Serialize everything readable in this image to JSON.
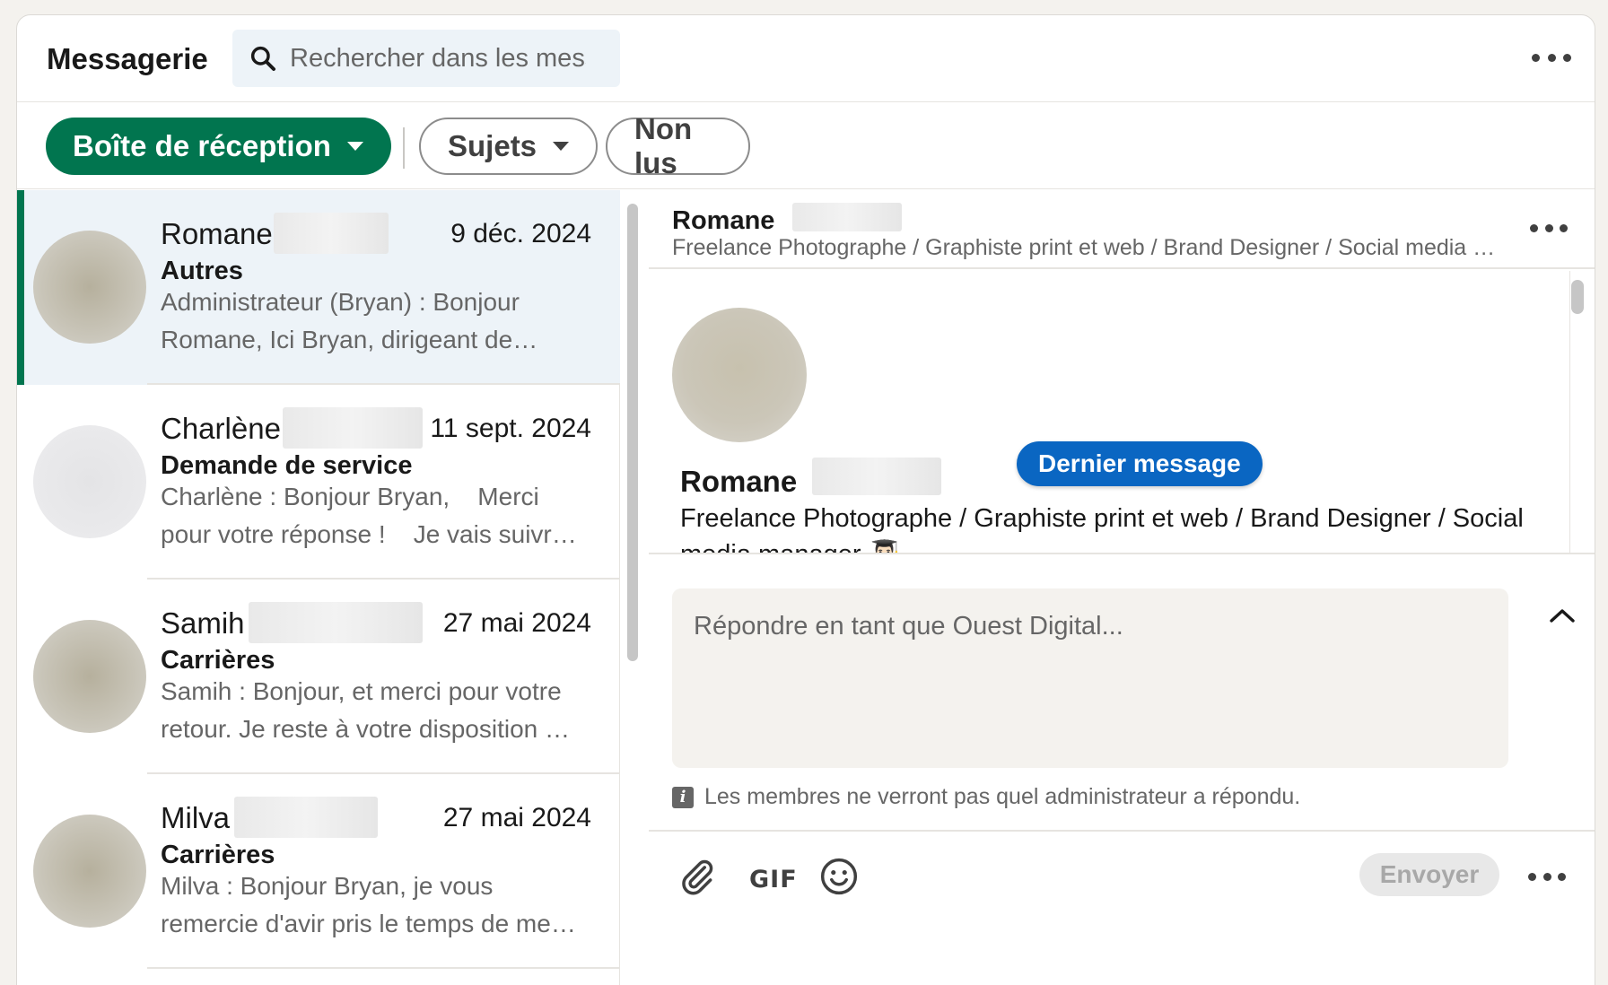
{
  "header": {
    "title": "Messagerie",
    "search_placeholder": "Rechercher dans les messages"
  },
  "filters": {
    "inbox": "Boîte de réception",
    "topics": "Sujets",
    "unread": "Non lus"
  },
  "conversations": [
    {
      "name": "Romane",
      "date": "9 déc. 2024",
      "category": "Autres",
      "preview": "Administrateur (Bryan) : Bonjour Romane, Ici Bryan, dirigeant de…"
    },
    {
      "name": "Charlène",
      "date": "11 sept. 2024",
      "category": "Demande de service",
      "preview": "Charlène : Bonjour Bryan,    Merci pour votre réponse !    Je vais suivr…"
    },
    {
      "name": "Samih",
      "date": "27 mai 2024",
      "category": "Carrières",
      "preview": "Samih : Bonjour, et merci pour votre retour. Je reste à votre disposition …"
    },
    {
      "name": "Milva",
      "date": "27 mai 2024",
      "category": "Carrières",
      "preview": "Milva : Bonjour Bryan, je vous remercie d'avir pris le temps de me…"
    }
  ],
  "detail": {
    "name": "Romane",
    "subtitle": "Freelance Photographe / Graphiste print et web / Brand Designer / Social media …",
    "profile_name": "Romane",
    "headline": "Freelance Photographe / Graphiste print et web / Brand Designer / Social media manager 👨🏻‍🎓",
    "last_message_badge": "Dernier message",
    "reply_placeholder": "Répondre en tant que Ouest Digital...",
    "info_text": "Les membres ne verront pas quel administrateur a répondu.",
    "gif_label": "GIF",
    "send_label": "Envoyer"
  },
  "colors": {
    "accent_green": "#01754f",
    "accent_blue": "#0a66c2",
    "active_row": "#edf3f8"
  }
}
